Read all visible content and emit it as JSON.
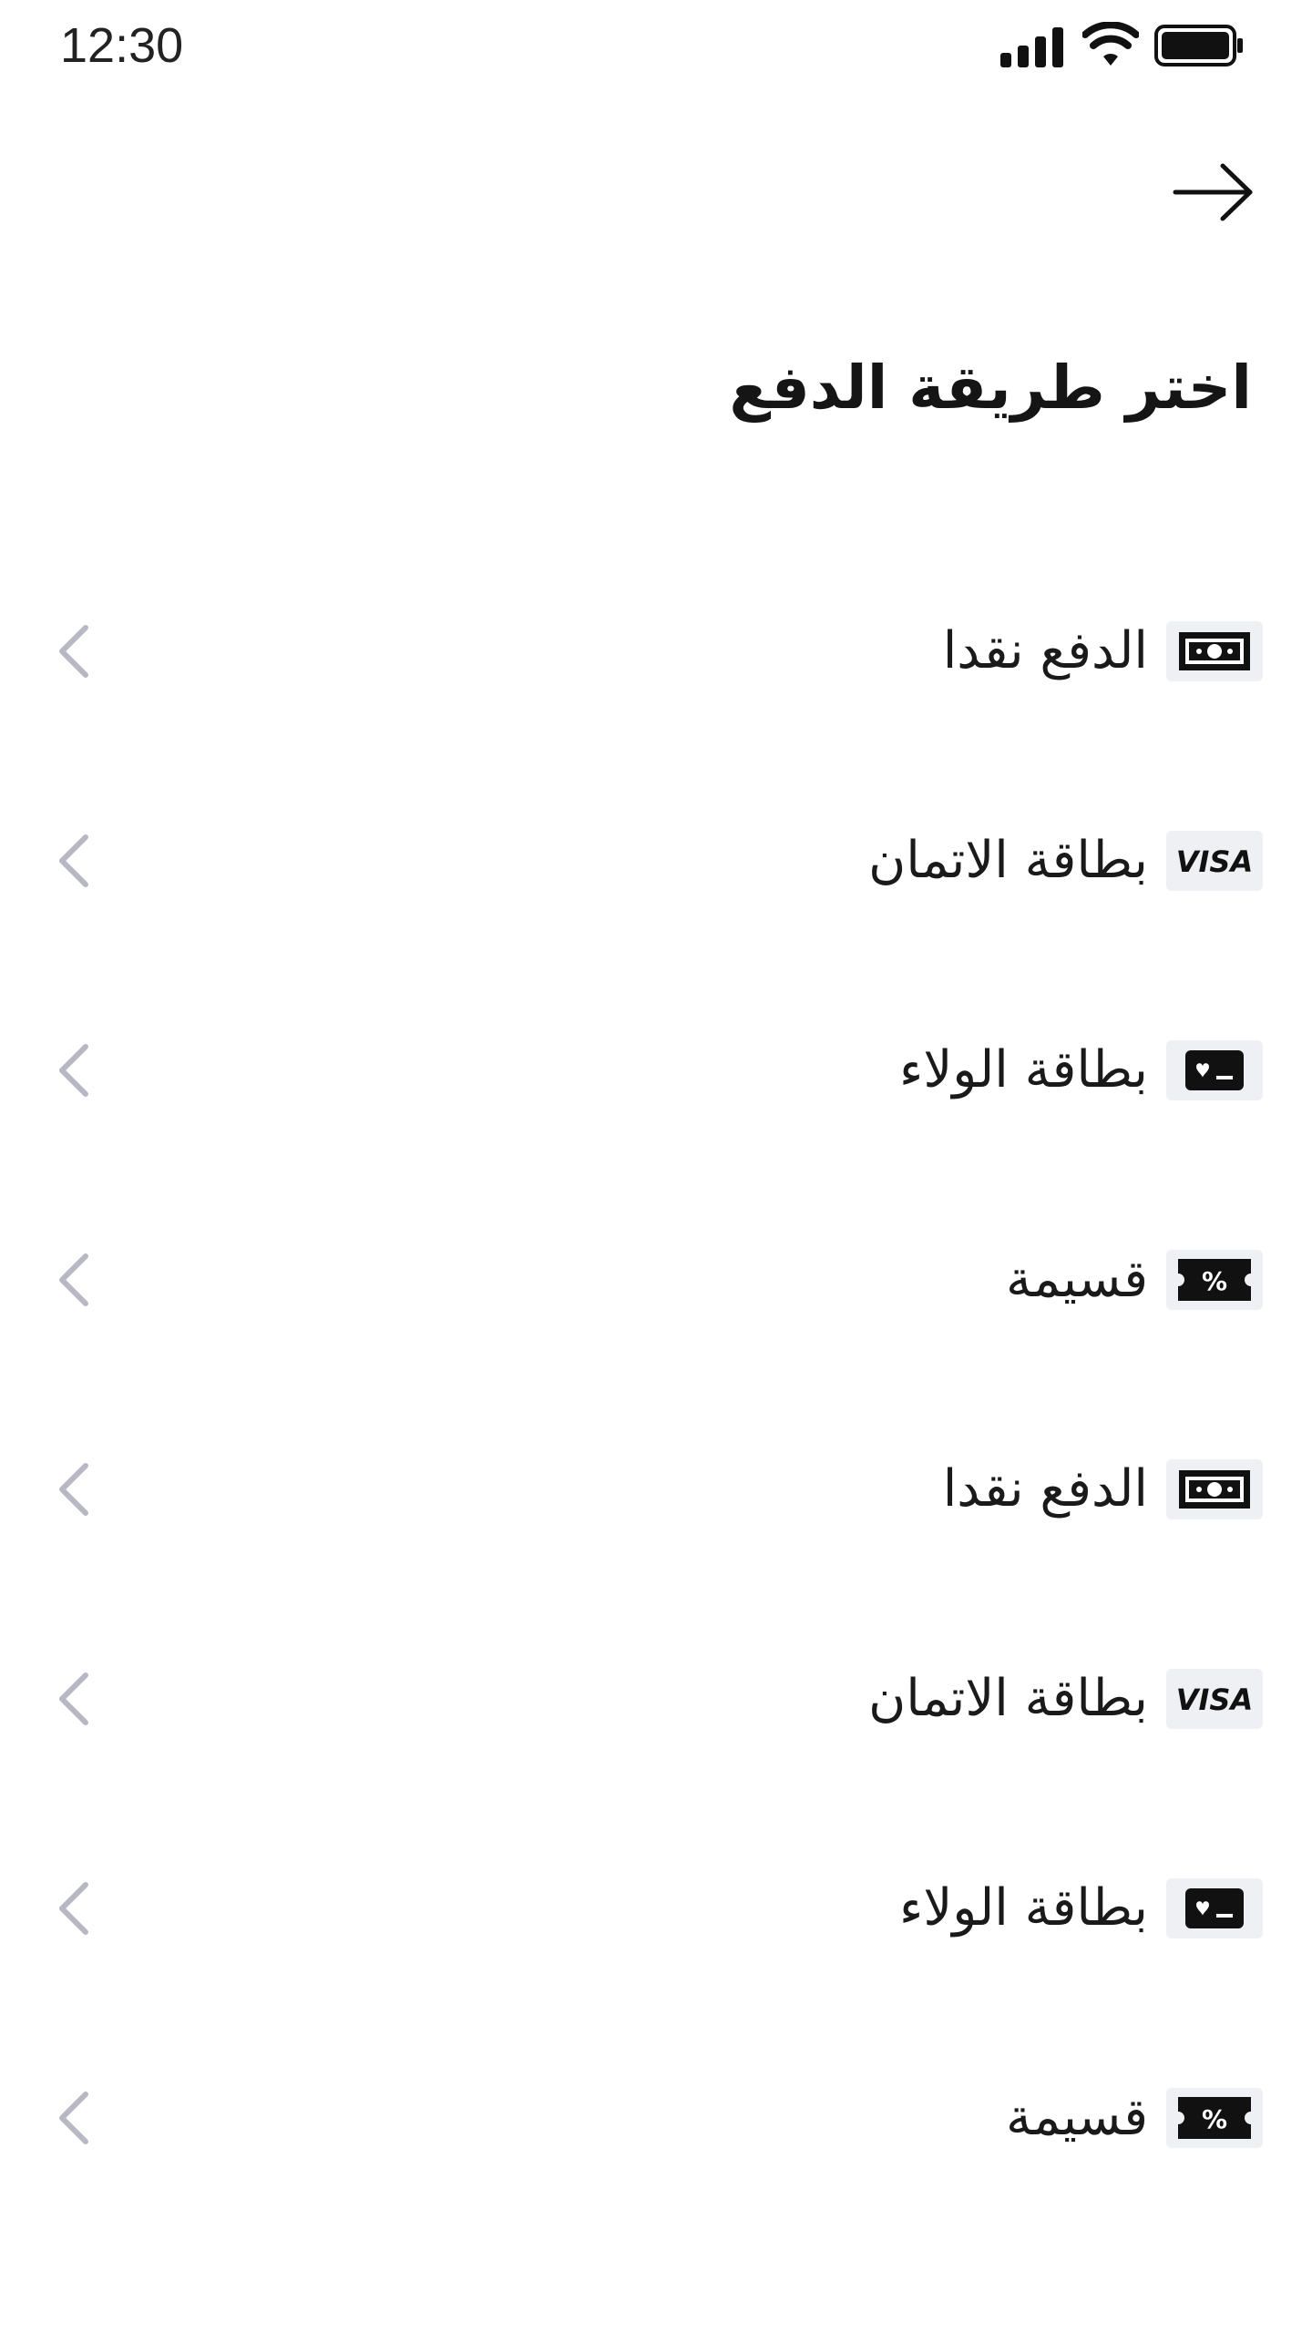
{
  "status_bar": {
    "time": "12:30",
    "icons": [
      "signal-icon",
      "wifi-icon",
      "battery-icon"
    ]
  },
  "header": {
    "back_icon": "arrow-right-icon",
    "title": "اختر طريقة الدفع"
  },
  "colors": {
    "icon_bg": "#eef0f4",
    "chevron": "#b8b8c4",
    "text": "#1a1a1a"
  },
  "payment_methods": [
    {
      "label": "الدفع نقدا",
      "icon": "cash-icon"
    },
    {
      "label": "بطاقة الاتمان",
      "icon": "visa-icon",
      "icon_text": "VISA"
    },
    {
      "label": "بطاقة الولاء",
      "icon": "loyalty-card-icon"
    },
    {
      "label": "قسيمة",
      "icon": "coupon-icon",
      "icon_text": "%"
    },
    {
      "label": "الدفع نقدا",
      "icon": "cash-icon"
    },
    {
      "label": "بطاقة الاتمان",
      "icon": "visa-icon",
      "icon_text": "VISA"
    },
    {
      "label": "بطاقة الولاء",
      "icon": "loyalty-card-icon"
    },
    {
      "label": "قسيمة",
      "icon": "coupon-icon",
      "icon_text": "%"
    }
  ]
}
